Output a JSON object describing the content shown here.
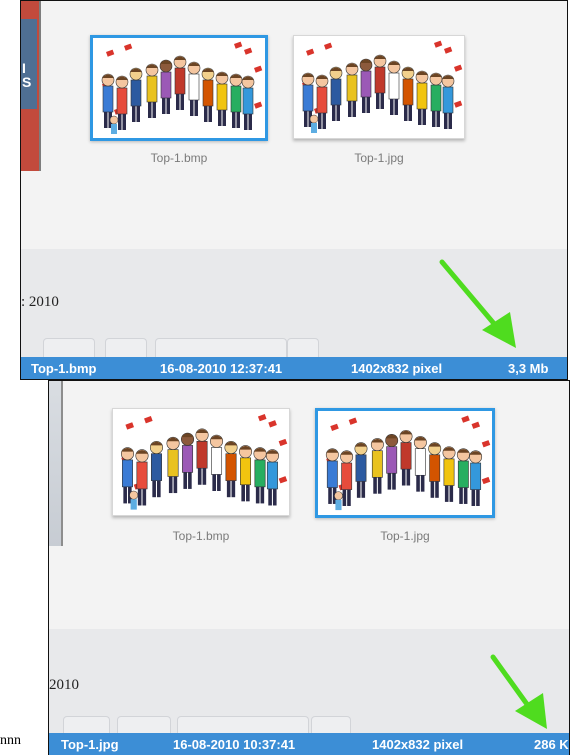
{
  "top_panel": {
    "files": [
      {
        "name": "Top-1.bmp",
        "selected": true
      },
      {
        "name": "Top-1.jpg",
        "selected": false
      }
    ],
    "date_partial": ": 2010",
    "status": {
      "filename": "Top-1.bmp",
      "datetime": "16-08-2010 12:37:41",
      "dimensions": "1402x832 pixel",
      "size": "3,3 Mb"
    }
  },
  "bottom_panel": {
    "files": [
      {
        "name": "Top-1.bmp",
        "selected": false
      },
      {
        "name": "Top-1.jpg",
        "selected": true
      }
    ],
    "date_partial": "2010",
    "status": {
      "filename": "Top-1.jpg",
      "datetime": "16-08-2010 10:37:41",
      "dimensions": "1402x832 pixel",
      "size": "286 K"
    }
  },
  "margin_text": "nnn",
  "colors": {
    "statusbar": "#3c8ed6",
    "selection": "#2f98e3",
    "arrow": "#4fdc1f"
  }
}
